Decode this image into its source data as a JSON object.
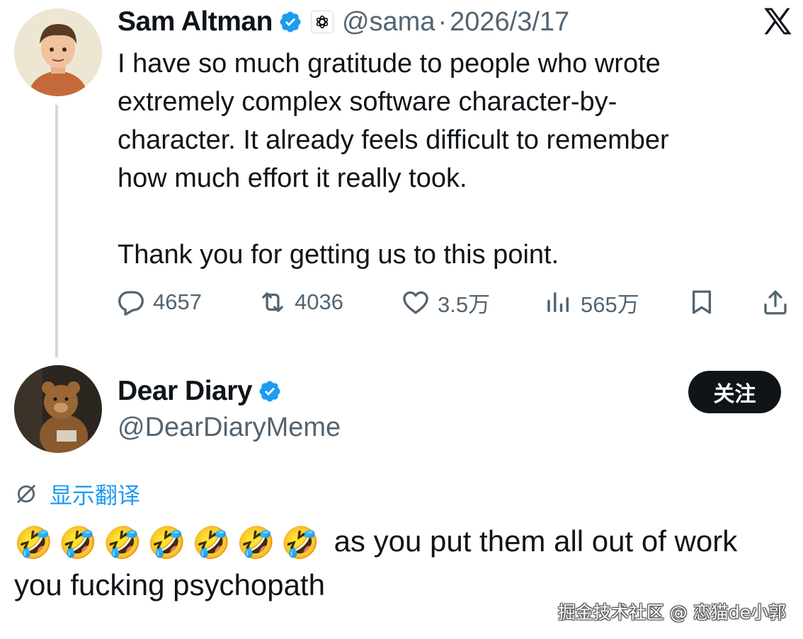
{
  "tweet1": {
    "author_name": "Sam Altman",
    "verified_icon": "verified-badge-icon",
    "affiliate_icon": "openai-logo-icon",
    "handle": "@sama",
    "separator": "·",
    "date": "2026/3/17",
    "body_lines": [
      "I have so much gratitude to people who wrote",
      "extremely complex software character-by-",
      "character. It already feels difficult to remember",
      "how much effort it really took."
    ],
    "body_second_paragraph": "Thank you for getting us to this point.",
    "actions": {
      "replies": "4657",
      "reposts": "4036",
      "likes": "3.5万",
      "views": "565万"
    }
  },
  "platform_icon": "x-logo-icon",
  "tweet2": {
    "author_name": "Dear Diary",
    "verified_icon": "verified-badge-icon",
    "handle": "@DearDiaryMeme",
    "follow_label": "关注",
    "translate_label": "显示翻译",
    "emojis": [
      "🤣",
      "🤣",
      "🤣",
      "🤣",
      "🤣",
      "🤣",
      "🤣"
    ],
    "body_text": "as you put them all out of work you fucking psychopath"
  },
  "watermark": "掘金技术社区 @ 恋猫de小郭",
  "colors": {
    "text": "#0f1419",
    "secondary": "#536471",
    "verified": "#1d9bf0",
    "link": "#1d9bf0"
  }
}
